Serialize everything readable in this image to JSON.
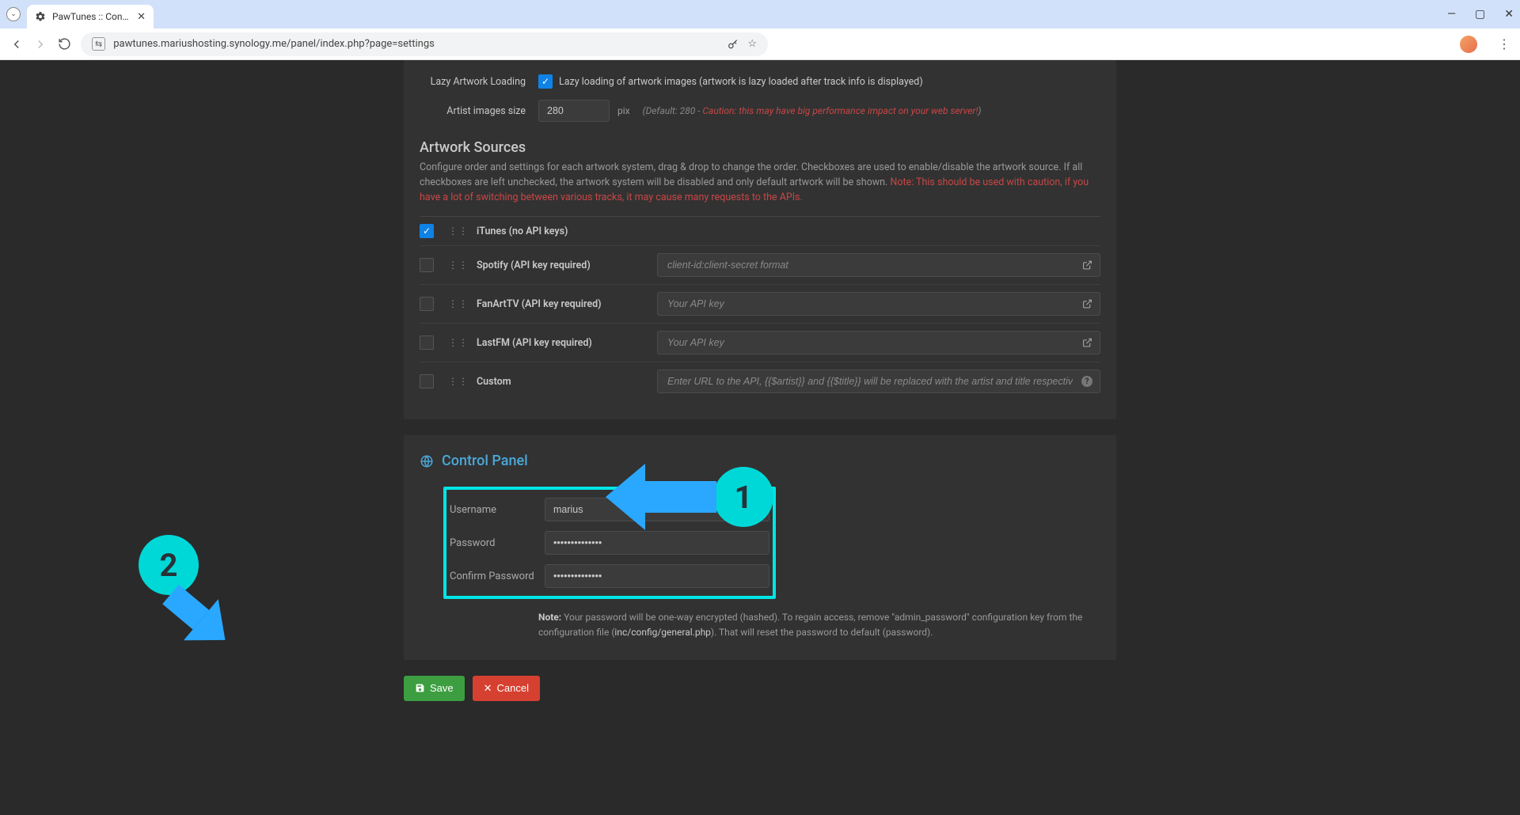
{
  "browser": {
    "tab_title": "PawTunes :: Control P",
    "url": "pawtunes.mariushosting.synology.me/panel/index.php?page=settings"
  },
  "artwork": {
    "lazy_label": "Lazy Artwork Loading",
    "lazy_desc": "Lazy loading of artwork images (artwork is lazy loaded after track info is displayed)",
    "size_label": "Artist images size",
    "size_value": "280",
    "size_suffix": "pix",
    "size_hint_prefix": "(Default: 280 - ",
    "size_hint_warn": "Caution: this may have big performance impact on your web server!",
    "size_hint_suffix": ")"
  },
  "sources": {
    "title": "Artwork Sources",
    "desc_pre": "Configure order and settings for each artwork system, drag & drop to change the order. Checkboxes are used to enable/disable the artwork source. If all checkboxes are left unchecked, the artwork system will be disabled and only default artwork will be shown. ",
    "desc_warn": "Note: This should be used with caution, if you have a lot of switching between various tracks, it may cause many requests to the APIs.",
    "rows": [
      {
        "name": "iTunes (no API keys)",
        "checked": true,
        "placeholder": ""
      },
      {
        "name": "Spotify (API key required)",
        "checked": false,
        "placeholder": "client-id:client-secret format",
        "link": true
      },
      {
        "name": "FanArtTV (API key required)",
        "checked": false,
        "placeholder": "Your API key",
        "link": true
      },
      {
        "name": "LastFM (API key required)",
        "checked": false,
        "placeholder": "Your API key",
        "link": true
      },
      {
        "name": "Custom",
        "checked": false,
        "placeholder": "Enter URL to the API, {{$artist}} and {{$title}} will be replaced with the artist and title respectively",
        "help": true
      }
    ]
  },
  "control_panel": {
    "title": "Control Panel",
    "username_label": "Username",
    "username_value": "marius",
    "password_label": "Password",
    "password_dots": "••••••••••••••",
    "confirm_label": "Confirm Password",
    "confirm_dots": "••••••••••••••",
    "note_bold": "Note:",
    "note_pre": " Your password will be one-way encrypted (hashed). To regain access, remove \"admin_password\" configuration key from the configuration file (",
    "note_mono": "inc/config/general.php",
    "note_post": "). That will reset the password to default (password)."
  },
  "actions": {
    "save": "Save",
    "cancel": "Cancel"
  },
  "callouts": {
    "one": "1",
    "two": "2"
  }
}
